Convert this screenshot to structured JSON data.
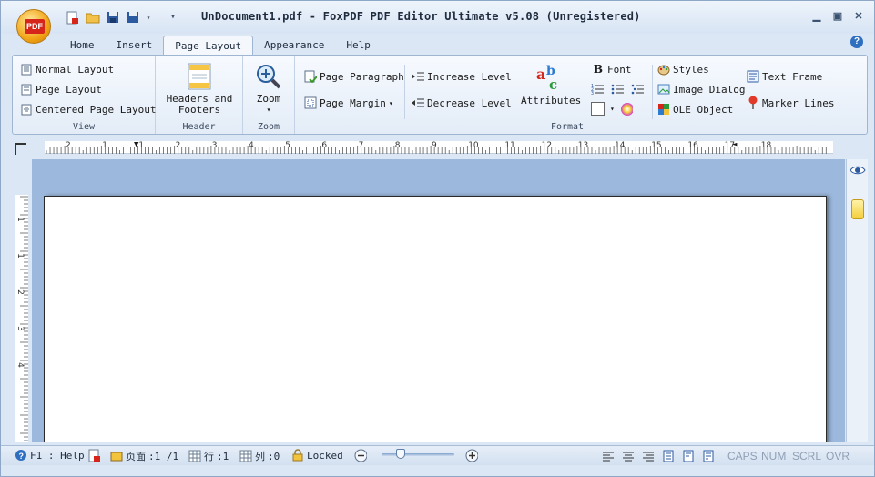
{
  "window": {
    "title": "UnDocument1.pdf - FoxPDF PDF Editor Ultimate v5.08 (Unregistered)",
    "app_badge": "PDF"
  },
  "tabs": [
    {
      "label": "Home"
    },
    {
      "label": "Insert"
    },
    {
      "label": "Page Layout",
      "active": true
    },
    {
      "label": "Appearance"
    },
    {
      "label": "Help"
    }
  ],
  "ribbon": {
    "view": {
      "label": "View",
      "normal_layout": "Normal Layout",
      "page_layout": "Page Layout",
      "centered_page_layout": "Centered Page Layout"
    },
    "header": {
      "label": "Header",
      "headers_footers_line1": "Headers and",
      "headers_footers_line2": "Footers"
    },
    "zoom": {
      "label": "Zoom",
      "zoom_button": "Zoom"
    },
    "format": {
      "label": "Format",
      "page_paragraph": "Page Paragraph",
      "page_margin": "Page Margin",
      "increase_level": "Increase Level",
      "decrease_level": "Decrease Level",
      "attributes": "Attributes",
      "font": "Font",
      "styles": "Styles",
      "image_dialog": "Image Dialog",
      "ole_object": "OLE Object",
      "text_frame": "Text Frame",
      "marker_lines": "Marker Lines"
    }
  },
  "ruler": {
    "horizontal_labels": [
      "2",
      "1",
      "1",
      "2",
      "3",
      "4",
      "5",
      "6",
      "7",
      "8",
      "9",
      "10",
      "11",
      "12",
      "13",
      "14",
      "15",
      "16",
      "17",
      "18"
    ],
    "vertical_labels": [
      "1",
      "1",
      "2",
      "3",
      "4"
    ]
  },
  "statusbar": {
    "help": "F1 : Help",
    "page_label": "页面",
    "page_value": ":1 /1",
    "row_label": "行",
    "row_value": ":1",
    "col_label": "列",
    "col_value": ":0",
    "locked": "Locked",
    "caps": "CAPS",
    "num": "NUM",
    "scrl": "SCRL",
    "ovr": "OVR"
  },
  "colors": {
    "workspace": "#9cb8dc",
    "ribbon_bg": "#e3ecf7",
    "pdf_red": "#d6261b"
  }
}
